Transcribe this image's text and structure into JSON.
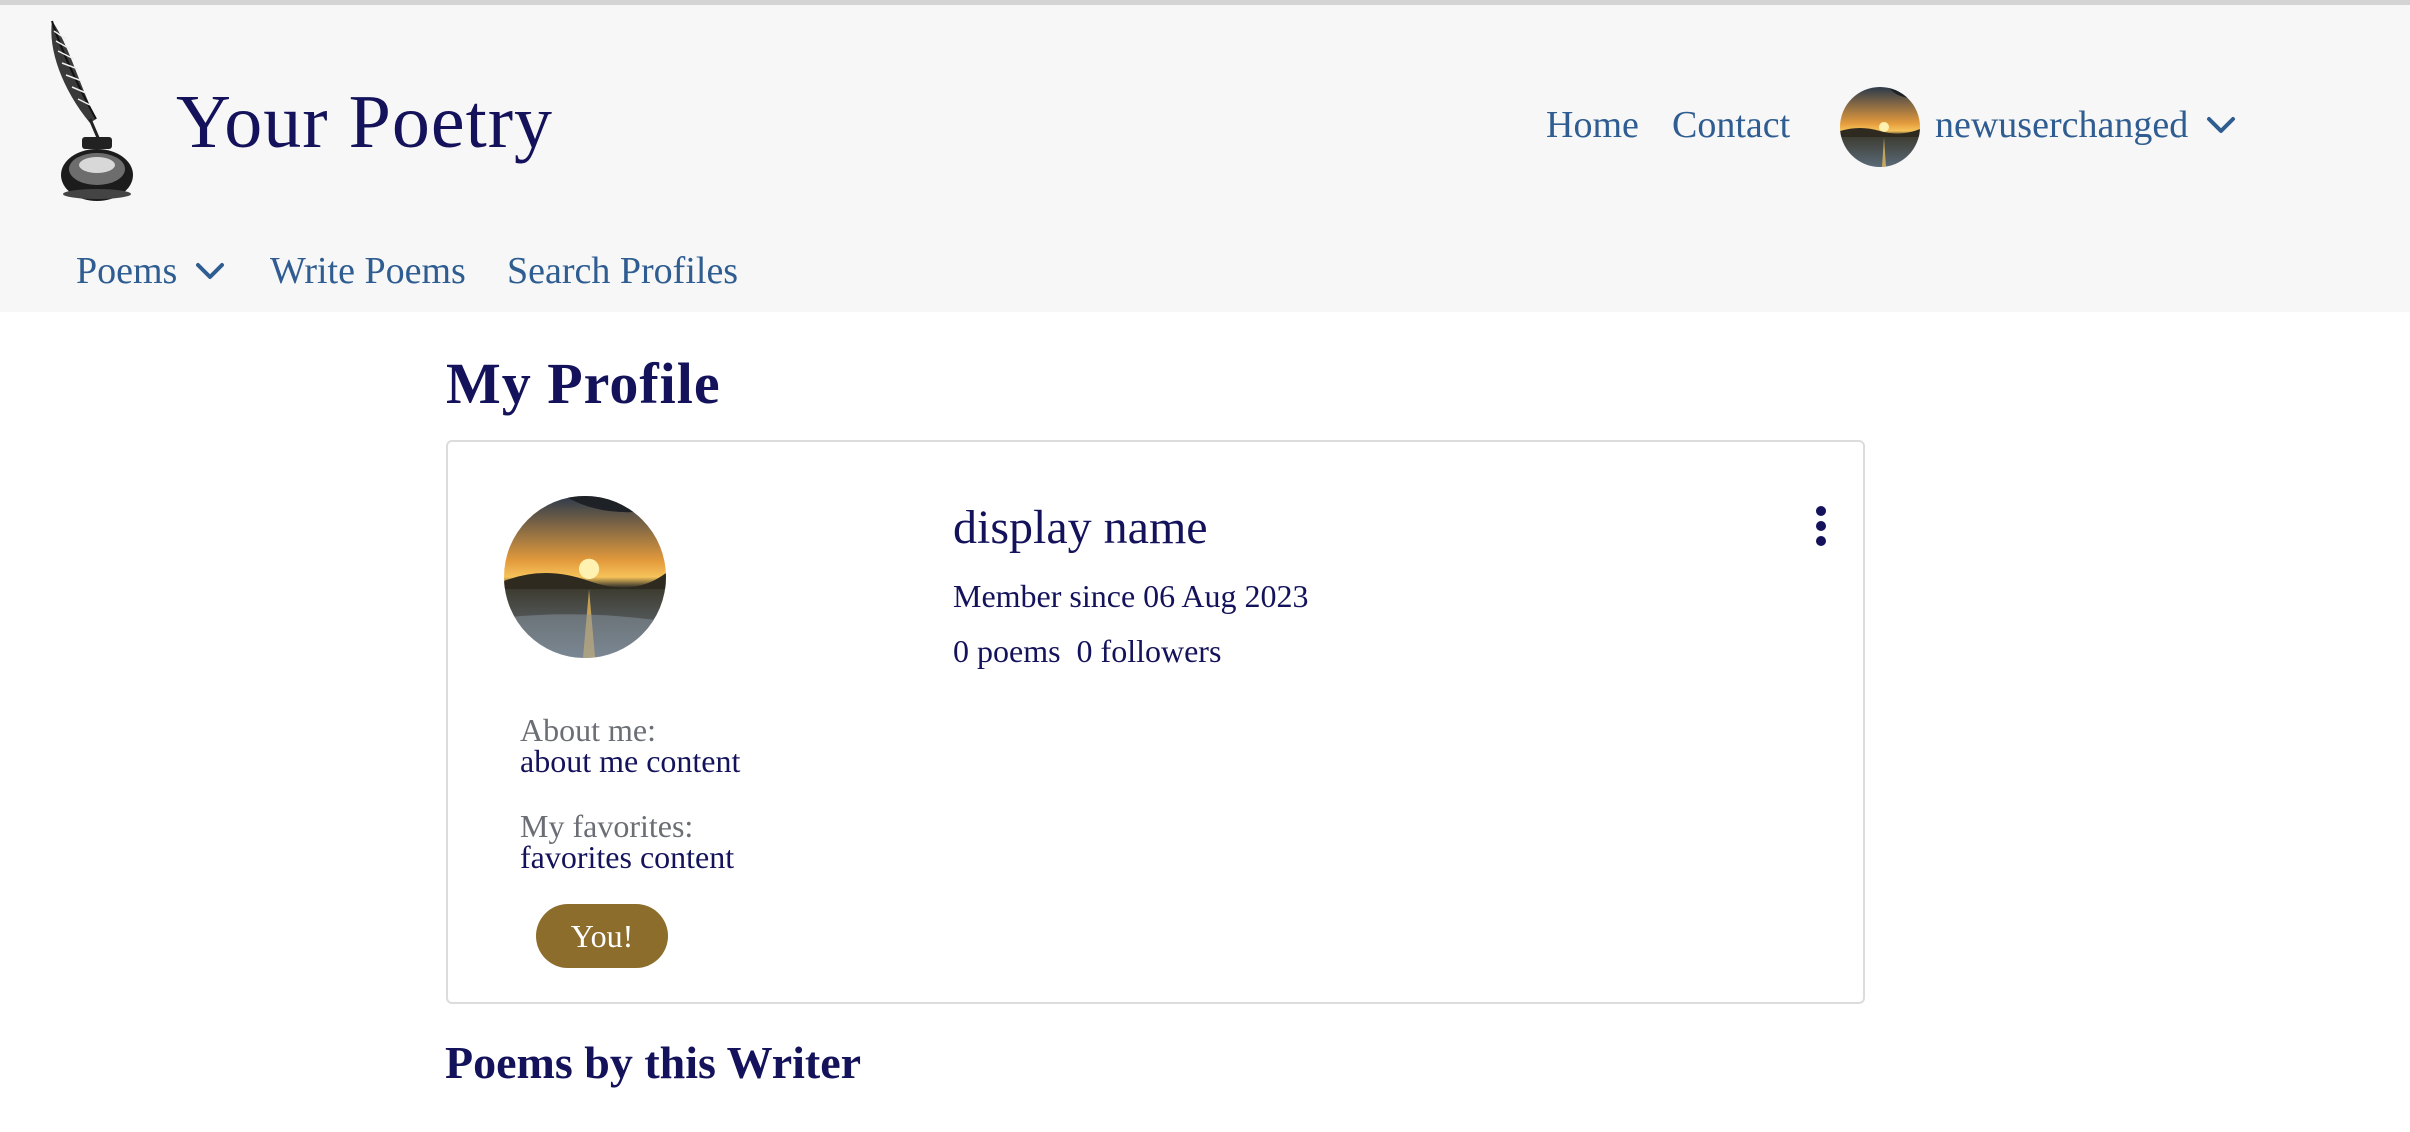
{
  "header": {
    "site_title": "Your Poetry",
    "nav": {
      "home": "Home",
      "contact": "Contact"
    },
    "user": {
      "username": "newuserchanged"
    },
    "subnav": {
      "poems": "Poems",
      "write_poems": "Write Poems",
      "search_profiles": "Search Profiles"
    }
  },
  "page": {
    "title": "My Profile"
  },
  "profile": {
    "display_name": "display name",
    "member_since": "Member since 06 Aug 2023",
    "stats": "0 poems  0 followers",
    "about_label": "About me:",
    "about_value": "about me content",
    "favorites_label": "My favorites:",
    "favorites_value": "favorites content",
    "badge": "You!"
  },
  "section": {
    "poems_title": "Poems by this Writer"
  },
  "colors": {
    "navy": "#13125a",
    "link_blue": "#2f5d91",
    "header_bg": "#f7f7f7",
    "badge_gold": "#8c6d2b",
    "muted": "#6b6e74"
  },
  "icons": [
    "quill-inkwell-logo",
    "chevron-down-icon",
    "kebab-menu-icon",
    "sunset-avatar-image"
  ]
}
